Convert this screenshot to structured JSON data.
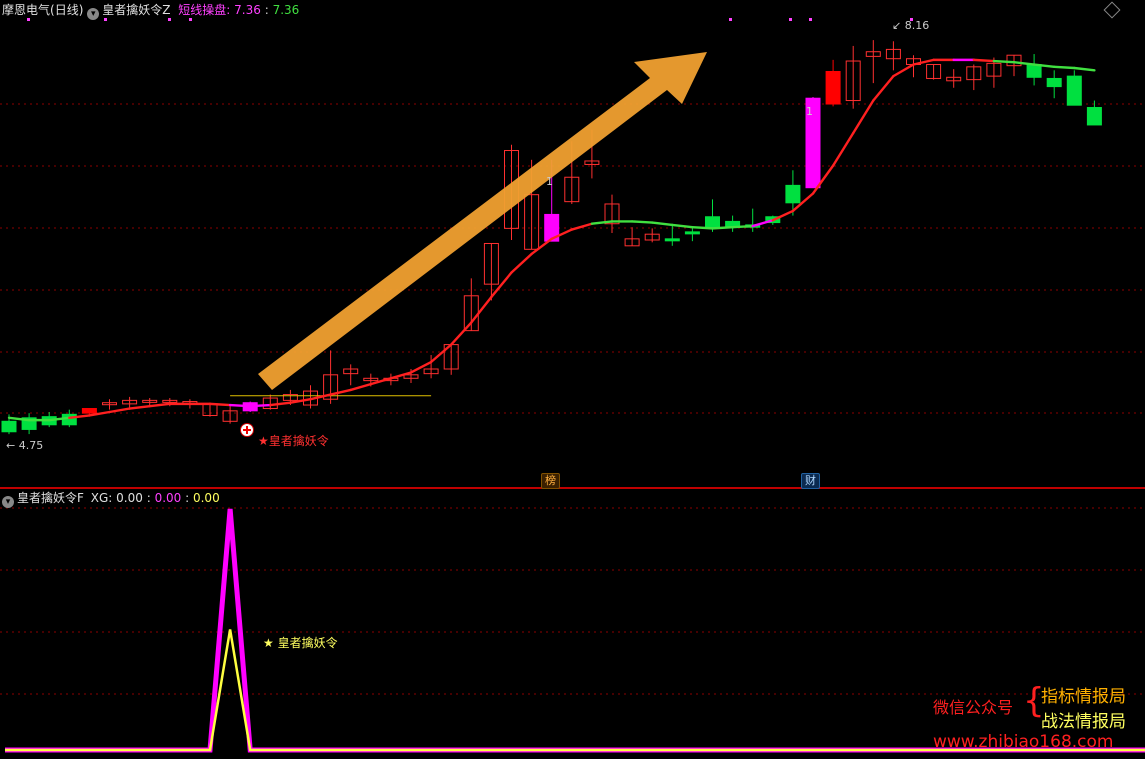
{
  "main_header": {
    "stock_name": "摩恩电气",
    "period": "(日线)",
    "indicator_name": "皇者擒妖令Z",
    "line_label": "短线操盘",
    "value_1": "7.36",
    "value_2": "7.36"
  },
  "sub_header": {
    "indicator_name": "皇者擒妖令F",
    "xg_label": "XG",
    "xg_value": "0.00",
    "value_2": "0.00",
    "value_3": "0.00"
  },
  "annotations": {
    "low_price": "4.75",
    "high_price": "8.16",
    "signal_label_main": "★皇者擒妖令",
    "signal_label_sub": "★ 皇者擒妖令",
    "limit_up_marker_1": "1",
    "limit_up_marker_2": "1",
    "tag_bang": "榜",
    "tag_cai": "财",
    "signal_icon": "plus-circle-icon"
  },
  "watermark": {
    "wechat_label": "微信公众号",
    "brace": "{",
    "account_1": "指标情报局",
    "account_2": "战法情报局",
    "url": "www.zhibiao168.com"
  },
  "colors": {
    "background": "#000000",
    "up_candle": "#ff3030",
    "down_candle": "#00e040",
    "limit_up_candle": "#ff00ff",
    "ma_line_up": "#ff2020",
    "ma_line_down": "#40e040",
    "arrow": "#f0a030",
    "signal_magenta": "#ff00ff",
    "signal_yellow": "#ffff40",
    "header_pink": "#ff40ff",
    "gridline": "#8b0000"
  },
  "chart_data": [
    {
      "type": "candlestick",
      "title": "皇者擒妖令Z",
      "ylim": [
        4.6,
        8.3
      ],
      "candles": [
        {
          "o": 4.89,
          "h": 4.95,
          "l": 4.78,
          "c": 4.8,
          "kind": "down"
        },
        {
          "o": 4.92,
          "h": 4.96,
          "l": 4.78,
          "c": 4.82,
          "kind": "down"
        },
        {
          "o": 4.93,
          "h": 4.97,
          "l": 4.84,
          "c": 4.86,
          "kind": "down"
        },
        {
          "o": 4.95,
          "h": 4.99,
          "l": 4.84,
          "c": 4.86,
          "kind": "down"
        },
        {
          "o": 4.96,
          "h": 5.0,
          "l": 4.95,
          "c": 5.0,
          "kind": "upfill"
        },
        {
          "o": 5.04,
          "h": 5.08,
          "l": 4.99,
          "c": 5.05,
          "kind": "up"
        },
        {
          "o": 5.04,
          "h": 5.1,
          "l": 5.0,
          "c": 5.07,
          "kind": "up"
        },
        {
          "o": 5.06,
          "h": 5.09,
          "l": 5.03,
          "c": 5.07,
          "kind": "up"
        },
        {
          "o": 5.06,
          "h": 5.09,
          "l": 5.02,
          "c": 5.07,
          "kind": "up"
        },
        {
          "o": 5.04,
          "h": 5.08,
          "l": 5.0,
          "c": 5.06,
          "kind": "up"
        },
        {
          "o": 5.04,
          "h": 5.05,
          "l": 4.93,
          "c": 4.94,
          "kind": "up"
        },
        {
          "o": 4.98,
          "h": 5.02,
          "l": 4.87,
          "c": 4.89,
          "kind": "up"
        },
        {
          "o": 4.98,
          "h": 5.06,
          "l": 4.97,
          "c": 5.05,
          "kind": "limit"
        },
        {
          "o": 5.0,
          "h": 5.12,
          "l": 4.99,
          "c": 5.09,
          "kind": "up"
        },
        {
          "o": 5.07,
          "h": 5.16,
          "l": 5.03,
          "c": 5.12,
          "kind": "up"
        },
        {
          "o": 5.03,
          "h": 5.2,
          "l": 5.0,
          "c": 5.15,
          "kind": "up"
        },
        {
          "o": 5.08,
          "h": 5.5,
          "l": 5.04,
          "c": 5.29,
          "kind": "up"
        },
        {
          "o": 5.3,
          "h": 5.38,
          "l": 5.2,
          "c": 5.34,
          "kind": "up"
        },
        {
          "o": 5.24,
          "h": 5.3,
          "l": 5.19,
          "c": 5.26,
          "kind": "up"
        },
        {
          "o": 5.24,
          "h": 5.3,
          "l": 5.2,
          "c": 5.26,
          "kind": "up"
        },
        {
          "o": 5.26,
          "h": 5.34,
          "l": 5.22,
          "c": 5.29,
          "kind": "up"
        },
        {
          "o": 5.3,
          "h": 5.46,
          "l": 5.26,
          "c": 5.34,
          "kind": "up"
        },
        {
          "o": 5.34,
          "h": 5.52,
          "l": 5.29,
          "c": 5.55,
          "kind": "up"
        },
        {
          "o": 5.67,
          "h": 6.12,
          "l": 5.67,
          "c": 5.97,
          "kind": "up"
        },
        {
          "o": 6.07,
          "h": 6.36,
          "l": 5.93,
          "c": 6.42,
          "kind": "up"
        },
        {
          "o": 6.55,
          "h": 7.27,
          "l": 6.45,
          "c": 7.22,
          "kind": "up"
        },
        {
          "o": 6.84,
          "h": 7.14,
          "l": 6.6,
          "c": 6.37,
          "kind": "up"
        },
        {
          "o": 6.67,
          "h": 7.14,
          "l": 6.59,
          "c": 6.44,
          "kind": "limit"
        },
        {
          "o": 6.99,
          "h": 7.3,
          "l": 6.76,
          "c": 6.78,
          "kind": "up"
        },
        {
          "o": 7.13,
          "h": 7.4,
          "l": 6.98,
          "c": 7.1,
          "kind": "up"
        },
        {
          "o": 6.76,
          "h": 6.84,
          "l": 6.51,
          "c": 6.59,
          "kind": "up"
        },
        {
          "o": 6.46,
          "h": 6.56,
          "l": 6.4,
          "c": 6.4,
          "kind": "up"
        },
        {
          "o": 6.5,
          "h": 6.55,
          "l": 6.43,
          "c": 6.45,
          "kind": "up"
        },
        {
          "o": 6.46,
          "h": 6.58,
          "l": 6.4,
          "c": 6.45,
          "kind": "down"
        },
        {
          "o": 6.52,
          "h": 6.55,
          "l": 6.44,
          "c": 6.51,
          "kind": "down"
        },
        {
          "o": 6.65,
          "h": 6.8,
          "l": 6.52,
          "c": 6.55,
          "kind": "down"
        },
        {
          "o": 6.61,
          "h": 6.66,
          "l": 6.52,
          "c": 6.56,
          "kind": "down"
        },
        {
          "o": 6.56,
          "h": 6.72,
          "l": 6.52,
          "c": 6.58,
          "kind": "down"
        },
        {
          "o": 6.65,
          "h": 6.66,
          "l": 6.58,
          "c": 6.6,
          "kind": "down"
        },
        {
          "o": 6.77,
          "h": 7.05,
          "l": 6.66,
          "c": 6.92,
          "kind": "down"
        },
        {
          "o": 6.9,
          "h": 7.68,
          "l": 6.9,
          "c": 7.67,
          "kind": "limit"
        },
        {
          "o": 7.62,
          "h": 8.0,
          "l": 7.6,
          "c": 7.9,
          "kind": "limit-red"
        },
        {
          "o": 7.65,
          "h": 8.12,
          "l": 7.58,
          "c": 7.99,
          "kind": "up"
        },
        {
          "o": 8.03,
          "h": 8.17,
          "l": 7.8,
          "c": 8.07,
          "kind": "up"
        },
        {
          "o": 8.01,
          "h": 8.16,
          "l": 7.91,
          "c": 8.09,
          "kind": "up"
        },
        {
          "o": 8.01,
          "h": 8.04,
          "l": 7.85,
          "c": 7.96,
          "kind": "up"
        },
        {
          "o": 7.96,
          "h": 7.95,
          "l": 7.83,
          "c": 7.84,
          "kind": "up"
        },
        {
          "o": 7.85,
          "h": 7.92,
          "l": 7.76,
          "c": 7.82,
          "kind": "up"
        },
        {
          "o": 7.94,
          "h": 7.96,
          "l": 7.74,
          "c": 7.83,
          "kind": "up"
        },
        {
          "o": 7.97,
          "h": 8.02,
          "l": 7.76,
          "c": 7.86,
          "kind": "up"
        },
        {
          "o": 8.04,
          "h": 8.01,
          "l": 7.86,
          "c": 7.95,
          "kind": "up"
        },
        {
          "o": 7.96,
          "h": 8.05,
          "l": 7.78,
          "c": 7.85,
          "kind": "down"
        },
        {
          "o": 7.84,
          "h": 7.91,
          "l": 7.67,
          "c": 7.77,
          "kind": "down"
        },
        {
          "o": 7.86,
          "h": 7.91,
          "l": 7.74,
          "c": 7.61,
          "kind": "down"
        },
        {
          "o": 7.59,
          "h": 7.65,
          "l": 7.44,
          "c": 7.44,
          "kind": "down"
        }
      ],
      "ma": [
        4.92,
        4.9,
        4.9,
        4.92,
        4.94,
        4.97,
        5.0,
        5.02,
        5.04,
        5.04,
        5.04,
        5.03,
        5.02,
        5.03,
        5.05,
        5.08,
        5.12,
        5.16,
        5.21,
        5.26,
        5.31,
        5.4,
        5.55,
        5.74,
        5.96,
        6.17,
        6.33,
        6.46,
        6.54,
        6.59,
        6.61,
        6.61,
        6.6,
        6.58,
        6.56,
        6.55,
        6.56,
        6.57,
        6.62,
        6.7,
        6.85,
        7.09,
        7.37,
        7.65,
        7.86,
        7.96,
        8.0,
        8.0,
        8.0,
        7.99,
        7.98,
        7.96,
        7.94,
        7.93,
        7.91
      ],
      "ma_color_split": [
        null,
        "down",
        "down",
        "down",
        "up",
        "up",
        "up",
        "up",
        "up",
        "up",
        "up",
        "up",
        "limit",
        "limit",
        "up",
        "up",
        "up",
        "up",
        "up",
        "up",
        "up",
        "up",
        "up",
        "up",
        "up",
        "up",
        "up",
        "up",
        "up",
        "up",
        "down",
        "down",
        "down",
        "down",
        "down",
        "down",
        "down",
        "down",
        "limit",
        "up",
        "up",
        "up",
        "up",
        "up",
        "up",
        "up",
        "up",
        "up",
        "limit",
        "up",
        "down",
        "down",
        "down",
        "down",
        "down"
      ],
      "support_line": {
        "from_index": 11,
        "to_index": 21,
        "value": 5.11
      }
    },
    {
      "type": "line",
      "title": "皇者擒妖令F",
      "series": [
        {
          "name": "XG",
          "color": "#ff00ff",
          "values": [
            0,
            0,
            0,
            0,
            0,
            0,
            0,
            0,
            0,
            0,
            0,
            1,
            0,
            0,
            0,
            0,
            0,
            0,
            0,
            0,
            0,
            0,
            0,
            0,
            0,
            0,
            0,
            0,
            0,
            0,
            0,
            0,
            0,
            0,
            0,
            0,
            0,
            0,
            0,
            0,
            0,
            0,
            0,
            0,
            0,
            0,
            0,
            0,
            0,
            0,
            0,
            0,
            0,
            0,
            0
          ]
        },
        {
          "color": "#ffff40",
          "values": [
            0,
            0,
            0,
            0,
            0,
            0,
            0,
            0,
            0,
            0,
            0,
            0.5,
            0,
            0,
            0,
            0,
            0,
            0,
            0,
            0,
            0,
            0,
            0,
            0,
            0,
            0,
            0,
            0,
            0,
            0,
            0,
            0,
            0,
            0,
            0,
            0,
            0,
            0,
            0,
            0,
            0,
            0,
            0,
            0,
            0,
            0,
            0,
            0,
            0,
            0,
            0,
            0,
            0,
            0,
            0
          ]
        }
      ],
      "ylim": [
        0,
        1
      ]
    }
  ]
}
